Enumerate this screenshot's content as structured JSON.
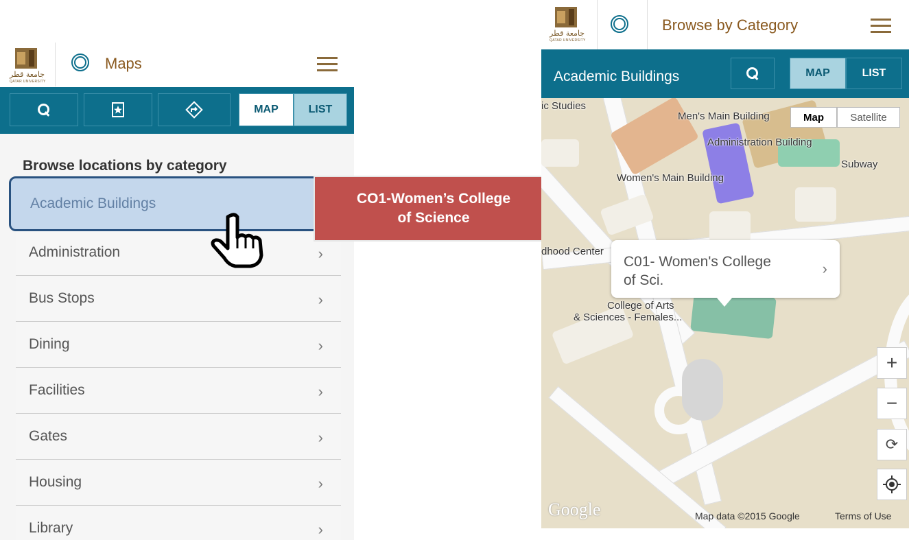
{
  "left": {
    "logo": {
      "arabic": "جامعة قطر",
      "english": "QATAR UNIVERSITY"
    },
    "header_title": "Maps",
    "toolbar": {
      "map_label": "MAP",
      "list_label": "LIST"
    },
    "browse_heading": "Browse locations by category",
    "selected_item": "Academic Buildings",
    "categories": [
      "Administration",
      "Bus Stops",
      "Dining",
      "Facilities",
      "Gates",
      "Housing",
      "Library"
    ],
    "chevron": "›"
  },
  "callout": {
    "line1": "CO1-Women’s College",
    "line2": "of Science",
    "color": "#c0504d"
  },
  "right": {
    "logo": {
      "arabic": "جامعة قطر",
      "english": "QATAR UNIVERSITY"
    },
    "header_title": "Browse by Category",
    "subbar_title": "Academic Buildings",
    "toolbar": {
      "map_label": "MAP",
      "list_label": "LIST"
    },
    "map": {
      "type_map": "Map",
      "type_satellite": "Satellite",
      "labels": {
        "studies": "ic Studies",
        "mens_main": "Men's Main Building",
        "admin": "Administration Building",
        "subway": "Subway",
        "womens_main": "Women's Main Building",
        "hood_center": "dhood Center",
        "arts_1": "College of Arts",
        "arts_2": "& Sciences -  Females..."
      },
      "info_line1": "C01- Women's College",
      "info_line2": "of Sci.",
      "zoom_in": "+",
      "zoom_out": "−",
      "google": "Google",
      "attribution": "Map data ©2015 Google",
      "terms": "Terms of Use"
    }
  },
  "colors": {
    "teal": "#0d6f8c",
    "brown": "#8a5a20",
    "active_tab": "#a9d3e0"
  }
}
